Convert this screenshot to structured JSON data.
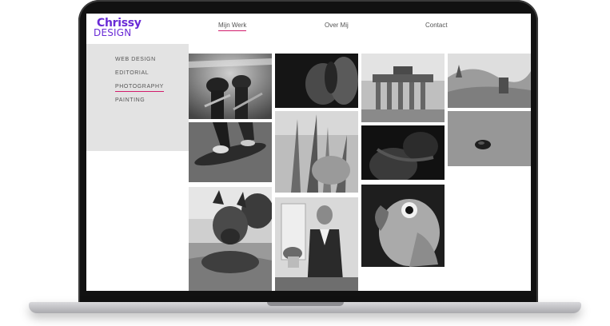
{
  "site": {
    "logo_line1": "Chrissy",
    "logo_line2": "DESIGN",
    "brand_color": "#6a2bd6",
    "accent_color": "#d11c6c"
  },
  "nav": {
    "items": [
      "Mijn Werk",
      "Over Mij",
      "Contact"
    ],
    "active": "Mijn Werk"
  },
  "categories": {
    "items": [
      "WEB DESIGN",
      "EDITORIAL",
      "PHOTOGRAPHY",
      "PAINTING"
    ],
    "active": "PHOTOGRAPHY"
  },
  "gallery": {
    "style": "black-and-white",
    "photos": [
      "photo-guitarists-icon",
      "photo-bare-back-icon",
      "photo-brandenburg-gate-icon",
      "photo-dunes-icon",
      "photo-skateboard-feet-icon",
      "photo-grass-closeup-icon",
      "photo-stone-on-sand-icon",
      "photo-neck-closeup-icon",
      "photo-dog-icon",
      "photo-man-with-plant-icon",
      "photo-parrot-icon"
    ]
  }
}
